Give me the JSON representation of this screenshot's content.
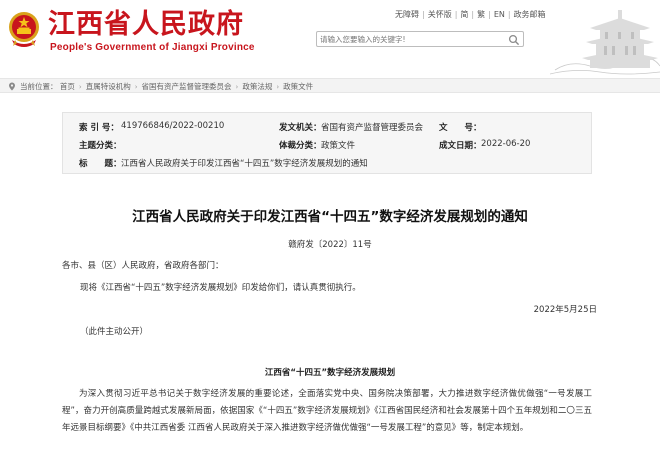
{
  "header": {
    "site_title": "江西省人民政府",
    "site_subtitle": "People's Government of Jiangxi Province",
    "top_links": [
      "无障碍",
      "关怀版",
      "简",
      "繁",
      "EN",
      "政务邮箱"
    ],
    "search_placeholder": "请输入您要输入的关键字!",
    "emblem": "national-emblem-icon",
    "brand_color": "#c8151d"
  },
  "breadcrumb": {
    "label": "当前位置：",
    "items": [
      "首页",
      "直属特设机构",
      "省国有资产监督管理委员会",
      "政策法规",
      "政策文件"
    ]
  },
  "meta": {
    "index_label": "索 引 号：",
    "index_value": "419766846/2022-00210",
    "issuer_label": "发文机关：",
    "issuer_value": "省国有资产监督管理委员会",
    "docnum_label": "文　　号：",
    "docnum_value": "",
    "topic_label": "主题分类：",
    "topic_value": "",
    "type_label": "体裁分类：",
    "type_value": "政策文件",
    "date_label": "成文日期：",
    "date_value": "2022-06-20",
    "title_label": "标　　题：",
    "title_value": "江西省人民政府关于印发江西省“十四五”数字经济发展规划的通知"
  },
  "article": {
    "title": "江西省人民政府关于印发江西省“十四五”数字经济发展规划的通知",
    "doc_number": "赣府发〔2022〕11号",
    "salutation": "各市、县（区）人民政府，省政府各部门：",
    "intro": "现将《江西省“十四五”数字经济发展规划》印发给你们，请认真贯彻执行。",
    "date": "2022年5月25日",
    "public_note": "（此件主动公开）",
    "plan_title": "江西省“十四五”数字经济发展规划",
    "body_paragraph": "为深入贯彻习近平总书记关于数字经济发展的重要论述，全面落实党中央、国务院决策部署，大力推进数字经济做优做强“一号发展工程”，奋力开创高质量跨越式发展新局面，依据国家《“十四五”数字经济发展规划》《江西省国民经济和社会发展第十四个五年规划和二〇三五年远景目标纲要》《中共江西省委 江西省人民政府关于深入推进数字经济做优做强“一号发展工程”的意见》等，制定本规划。"
  }
}
